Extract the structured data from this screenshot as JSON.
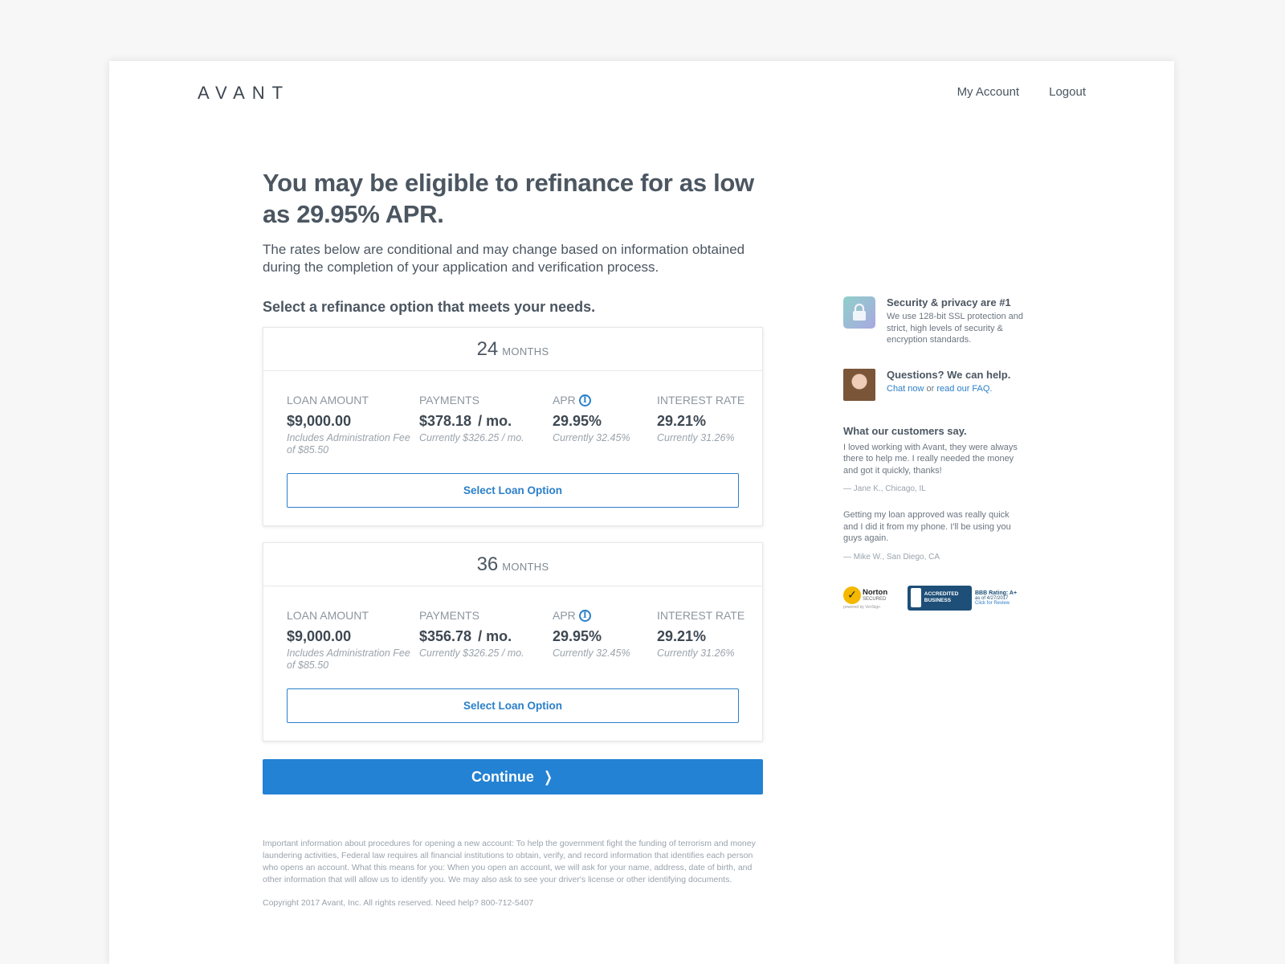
{
  "header": {
    "logo": "AVANT",
    "nav": [
      {
        "label": "My Account"
      },
      {
        "label": "Logout"
      }
    ]
  },
  "main": {
    "title": "You may be eligible to refinance for as low as 29.95% APR.",
    "subtitle": "The rates below are conditional and may change based on information obtained during the completion of your application and verification process.",
    "select_heading": "Select a refinance option that meets your needs.",
    "columns": {
      "loan_amount": "LOAN AMOUNT",
      "payments": "PAYMENTS",
      "apr": "APR",
      "interest_rate": "INTEREST RATE"
    },
    "options": [
      {
        "term": "24",
        "term_unit": "MONTHS",
        "loan_amount": "$9,000.00",
        "loan_note": "Includes Administration Fee of $85.50",
        "payment": "$378.18",
        "payment_unit": "/ mo.",
        "payment_note": "Currently $326.25 / mo.",
        "apr": "29.95%",
        "apr_note": "Currently 32.45%",
        "interest_rate": "29.21%",
        "interest_note": "Currently 31.26%",
        "button": "Select Loan Option"
      },
      {
        "term": "36",
        "term_unit": "MONTHS",
        "loan_amount": "$9,000.00",
        "loan_note": "Includes Administration Fee of $85.50",
        "payment": "$356.78",
        "payment_unit": "/ mo.",
        "payment_note": "Currently $326.25 / mo.",
        "apr": "29.95%",
        "apr_note": "Currently 32.45%",
        "interest_rate": "29.21%",
        "interest_note": "Currently 31.26%",
        "button": "Select Loan Option"
      }
    ],
    "continue_label": "Continue",
    "legal": "Important information about procedures for opening a new account: To help the government fight the funding of terrorism and money laundering activities, Federal law requires all financial institutions to obtain, verify, and record information that identifies each person who opens an account. What this means for you: When you open an account, we will ask for your name, address, date of birth, and other information that will allow us to identify you. We may also ask to see your driver's license or other identifying documents.",
    "copyright": "Copyright 2017 Avant, Inc. All rights reserved. Need help? 800-712-5407"
  },
  "sidebar": {
    "security_title": "Security & privacy are #1",
    "security_text": "We use 128-bit SSL protection and strict, high levels of security & encryption standards.",
    "help_title": "Questions? We can help.",
    "help_chat": "Chat now",
    "help_or": "or",
    "help_faq": "read our FAQ.",
    "testimonials_heading": "What our customers say.",
    "testimonials": [
      {
        "quote": "I loved working with Avant, they were always there to help me. I really needed the money and got it quickly, thanks!",
        "author": "— Jane K., Chicago, IL"
      },
      {
        "quote": "Getting my loan approved was really quick and I did it from my phone. I'll be using you guys again.",
        "author": "— Mike W., San Diego, CA"
      }
    ],
    "norton": {
      "name": "Norton",
      "secured": "SECURED",
      "powered": "powered by VeriSign"
    },
    "bbb": {
      "badge": "ACCREDITED BUSINESS",
      "rating": "BBB Rating: A+",
      "date": "as of 4/27/2017",
      "review": "Click for Review"
    }
  },
  "colors": {
    "accent": "#2382d3",
    "text": "#4b5661",
    "muted": "#9aa3ac"
  },
  "icons": [
    "logo-a-triangle",
    "info-icon",
    "chevron-right-icon",
    "lock-icon",
    "checkmark-icon"
  ]
}
